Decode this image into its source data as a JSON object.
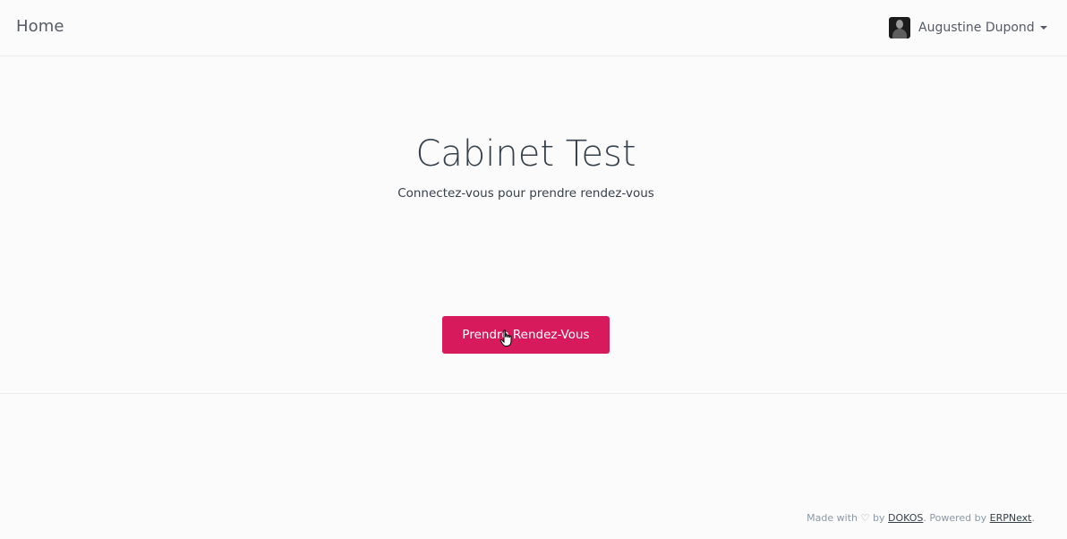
{
  "navbar": {
    "brand": "Home",
    "user": {
      "name": "Augustine Dupond",
      "avatar_icon": "user-avatar",
      "dropdown_icon": "caret-down-icon"
    }
  },
  "hero": {
    "title": "Cabinet Test",
    "subtitle": "Connectez-vous pour prendre rendez-vous",
    "button_label": "Prendre Rendez-Vous",
    "button_color": "#d71a5b"
  },
  "footer": {
    "made_with": "Made with",
    "heart": "♡",
    "by": "by",
    "dokos_link": "DOKOS",
    "powered_by": ". Powered by",
    "erpnext_link": "ERPNext",
    "end": "."
  },
  "colors": {
    "background": "#fbfbfb",
    "text": "#36414c",
    "muted": "#8d99a6",
    "accent": "#d71a5b"
  }
}
